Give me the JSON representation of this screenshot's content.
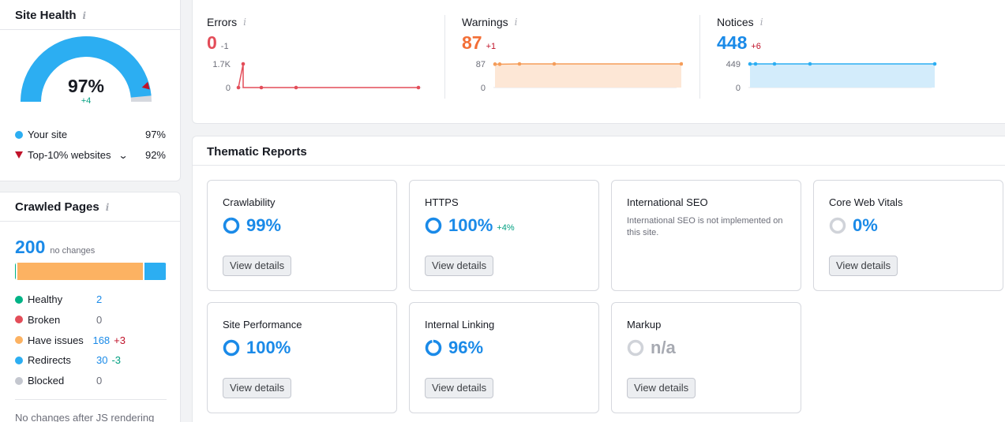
{
  "site_health": {
    "title": "Site Health",
    "info_icon": "i",
    "score": "97%",
    "delta": "+4",
    "your_site_label": "Your site",
    "your_site_value": "97%",
    "top10_label": "Top-10% websites",
    "top10_value": "92%",
    "score_fraction": 0.97,
    "top10_fraction": 0.92,
    "colors": {
      "accent": "#2caef2",
      "track": "#d5d8de",
      "marker": "#c0132a"
    }
  },
  "crawled_pages": {
    "title": "Crawled Pages",
    "info_icon": "i",
    "total": "200",
    "total_note": "no changes",
    "rows": [
      {
        "label": "Healthy",
        "value": "2",
        "change": "",
        "color": "#00b386"
      },
      {
        "label": "Broken",
        "value": "0",
        "change": "",
        "color": "#e34d59"
      },
      {
        "label": "Have issues",
        "value": "168",
        "change": "+3",
        "color": "#fcb262",
        "change_color": "#c0132a"
      },
      {
        "label": "Redirects",
        "value": "30",
        "change": "-3",
        "color": "#2caef2",
        "change_color": "#009f81"
      },
      {
        "label": "Blocked",
        "value": "0",
        "change": "",
        "color": "#c4c7cf"
      }
    ],
    "bar": [
      {
        "name": "Healthy",
        "count": 2,
        "color": "#00b386"
      },
      {
        "name": "Have issues",
        "count": 168,
        "color": "#fcb262"
      },
      {
        "name": "Redirects",
        "count": 30,
        "color": "#2caef2"
      }
    ],
    "footer": "No changes after JS rendering"
  },
  "issues": {
    "errors": {
      "label": "Errors",
      "info_icon": "i",
      "value": "0",
      "delta": "-1",
      "value_color": "#e34d59",
      "delta_color": "#6c6e79",
      "ymax_label": "1.7K",
      "ymin_label": "0",
      "series": [
        0,
        1700,
        0,
        0,
        0,
        0
      ],
      "ymax": 1700,
      "color": "#e34d59",
      "fill": false
    },
    "warnings": {
      "label": "Warnings",
      "info_icon": "i",
      "value": "87",
      "delta": "+1",
      "value_color": "#f36f37",
      "delta_color": "#c0132a",
      "ymax_label": "87",
      "ymin_label": "0",
      "series": [
        86,
        86,
        87,
        87,
        87
      ],
      "ymax": 87,
      "color": "#f59d5a",
      "fill": true,
      "fill_color": "#fde7d6"
    },
    "notices": {
      "label": "Notices",
      "info_icon": "i",
      "value": "448",
      "delta": "+6",
      "value_color": "#1a8ae8",
      "delta_color": "#c0132a",
      "ymax_label": "449",
      "ymin_label": "0",
      "series": [
        448,
        449,
        449,
        449,
        449
      ],
      "ymax": 449,
      "color": "#2caef2",
      "fill": true,
      "fill_color": "#d3ecfb"
    }
  },
  "thematic": {
    "title": "Thematic Reports",
    "view_details_label": "View details",
    "cards": [
      {
        "title": "Crawlability",
        "score": "99%",
        "change": "",
        "fraction": 0.99
      },
      {
        "title": "HTTPS",
        "score": "100%",
        "change": "+4%",
        "fraction": 1.0
      },
      {
        "title": "International SEO",
        "description": "International SEO is not implemented on this site."
      },
      {
        "title": "Core Web Vitals",
        "score": "0%",
        "change": "",
        "fraction": 0
      },
      {
        "title": "Site Performance",
        "score": "100%",
        "change": "",
        "fraction": 1.0
      },
      {
        "title": "Internal Linking",
        "score": "96%",
        "change": "",
        "fraction": 0.96
      },
      {
        "title": "Markup",
        "score": "n/a",
        "change": "",
        "fraction": null
      }
    ]
  }
}
